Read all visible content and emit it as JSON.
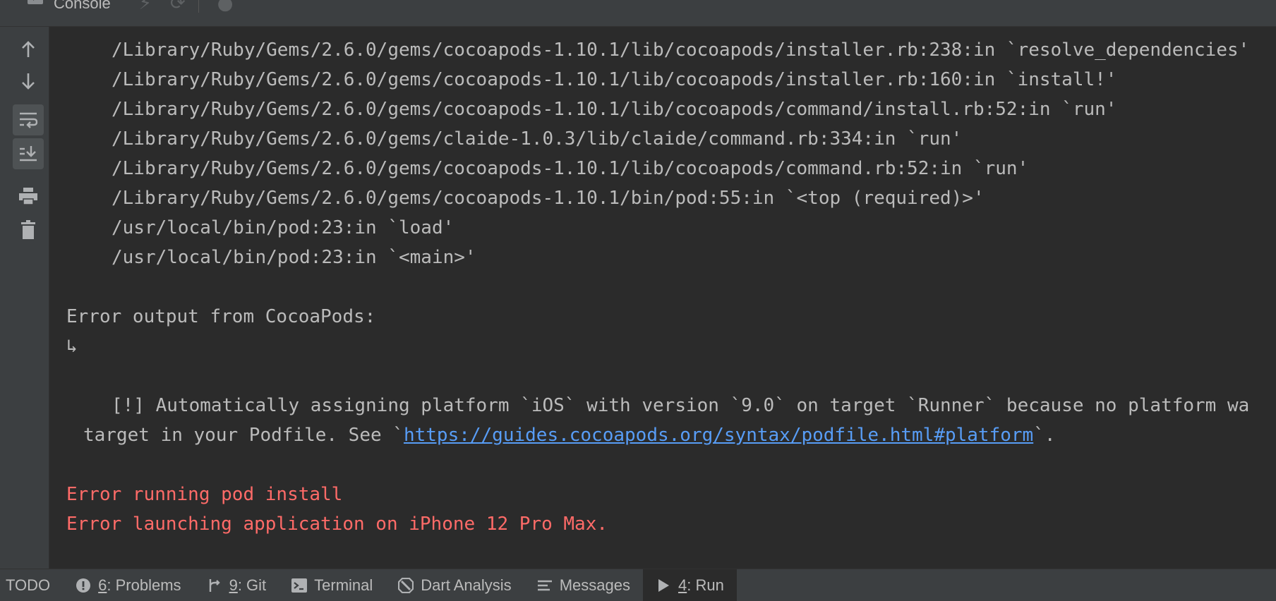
{
  "header": {
    "console_label": "Console",
    "icons": [
      "console-icon",
      "lightning-icon",
      "refresh-icon",
      "settings-icon"
    ]
  },
  "gutter": {
    "buttons": [
      {
        "name": "scroll-up",
        "icon": "arrow-up-icon"
      },
      {
        "name": "scroll-down",
        "icon": "arrow-down-icon"
      },
      {
        "name": "soft-wrap",
        "icon": "soft-wrap-icon",
        "active": true
      },
      {
        "name": "scroll-to-end",
        "icon": "scroll-to-end-icon",
        "active": true
      },
      {
        "name": "print",
        "icon": "printer-icon"
      },
      {
        "name": "clear-all",
        "icon": "trash-icon"
      }
    ]
  },
  "console": {
    "stack": [
      "/Library/Ruby/Gems/2.6.0/gems/cocoapods-1.10.1/lib/cocoapods/installer.rb:238:in `resolve_dependencies'",
      "/Library/Ruby/Gems/2.6.0/gems/cocoapods-1.10.1/lib/cocoapods/installer.rb:160:in `install!'",
      "/Library/Ruby/Gems/2.6.0/gems/cocoapods-1.10.1/lib/cocoapods/command/install.rb:52:in `run'",
      "/Library/Ruby/Gems/2.6.0/gems/claide-1.0.3/lib/claide/command.rb:334:in `run'",
      "/Library/Ruby/Gems/2.6.0/gems/cocoapods-1.10.1/lib/cocoapods/command.rb:52:in `run'",
      "/Library/Ruby/Gems/2.6.0/gems/cocoapods-1.10.1/bin/pod:55:in `<top (required)>'",
      "/usr/local/bin/pod:23:in `load'",
      "/usr/local/bin/pod:23:in `<main>'"
    ],
    "error_output_header": "Error output from CocoaPods:",
    "return_arrow": "↳",
    "warning_line": "[!] Automatically assigning platform `iOS` with version `9.0` on target `Runner` because no platform wa",
    "warning_cont_prefix": "target in your Podfile. See `",
    "warning_link": "https://guides.cocoapods.org/syntax/podfile.html#platform",
    "warning_cont_suffix": "`.",
    "error_pod_install": "Error running pod install",
    "error_launching": "Error launching application on iPhone 12 Pro Max."
  },
  "bottombar": {
    "todo": "TODO",
    "problems_num": "6",
    "problems_label": ": Problems",
    "git_num": "9",
    "git_label": ": Git",
    "terminal": "Terminal",
    "dart_analysis": "Dart Analysis",
    "messages": "Messages",
    "run_num": "4",
    "run_label": ": Run"
  }
}
